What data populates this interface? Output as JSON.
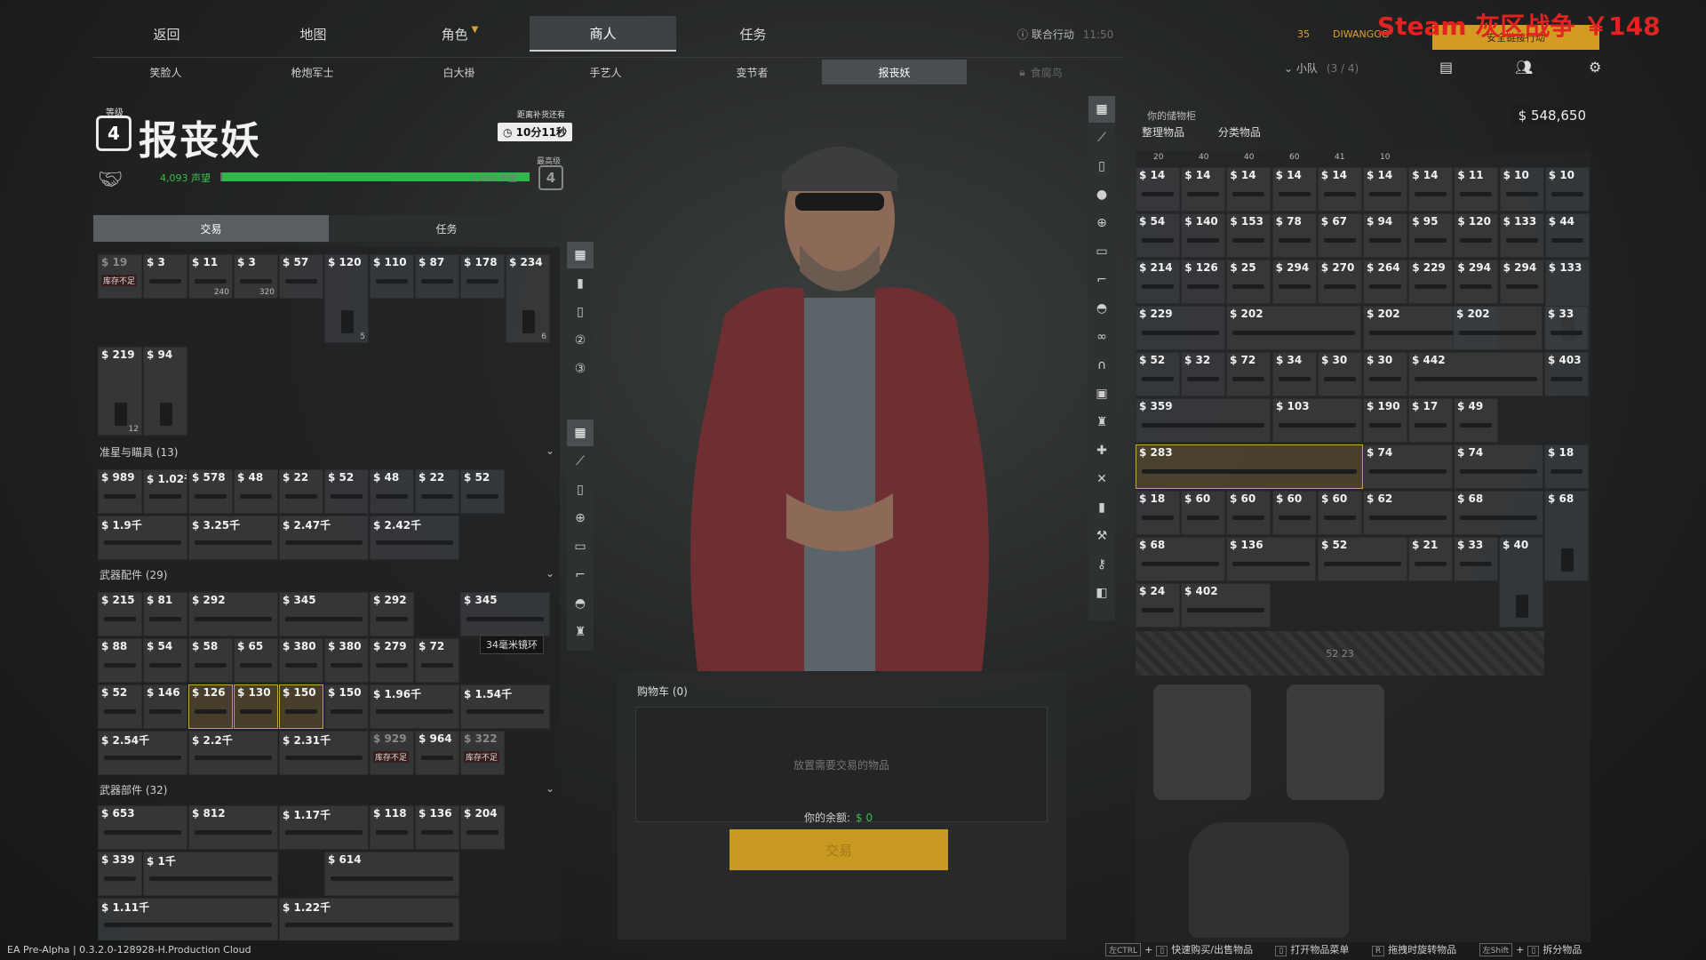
{
  "nav": {
    "tabs": [
      "返回",
      "地图",
      "角色",
      "商人",
      "任务"
    ],
    "active_index": 3,
    "joint_ops": "联合行动",
    "time": "11:50"
  },
  "subnav": {
    "tabs": [
      "笑脸人",
      "枪炮军士",
      "白大褂",
      "手艺人",
      "变节者",
      "报丧妖",
      "食腐鸟"
    ],
    "active_index": 5
  },
  "trader": {
    "level_label": "等级",
    "level": "4",
    "name": "报丧妖",
    "restock_label": "距离补货还有",
    "restock_timer": "10分11秒",
    "rep_current": "4,093 声望",
    "rep_max": "4,000 声望",
    "rep_fraction": 1.0,
    "max_label": "最高级",
    "max_level": "4"
  },
  "left_tabs": [
    "交易",
    "任务"
  ],
  "sections": {
    "sights": "准星与瞄具 (13)",
    "attachments": "武器配件 (29)",
    "parts": "武器部件 (32)"
  },
  "trader_items": {
    "row1": [
      {
        "p": "$ 19",
        "oos": "库存不足"
      },
      {
        "p": "$ 3"
      },
      {
        "p": "$ 11",
        "c": "240"
      },
      {
        "p": "$ 3",
        "c": "320"
      },
      {
        "p": "$ 57"
      },
      {
        "p": "$ 120",
        "c": "5"
      },
      {
        "p": "$ 110"
      },
      {
        "p": "$ 87"
      },
      {
        "p": "$ 178"
      },
      {
        "p": "$ 234",
        "c": "6"
      }
    ],
    "row2": [
      {
        "p": "$ 219",
        "c": "12"
      },
      {
        "p": "$ 94"
      }
    ],
    "sights_a": [
      "$ 989",
      "$ 1.02千",
      "$ 578",
      "$ 48",
      "$ 22",
      "$ 52",
      "$ 48",
      "$ 22",
      "$ 52"
    ],
    "sights_b": [
      "$ 1.9千",
      "$ 3.25千",
      "$ 2.47千",
      "$ 2.42千"
    ],
    "att_a": [
      "$ 215",
      "$ 81",
      "$ 292",
      "$ 345",
      "$ 292",
      "$ 345"
    ],
    "att_b": [
      "$ 88",
      "$ 54",
      "$ 58",
      "$ 65",
      "$ 380",
      "$ 380",
      "$ 279",
      "$ 72"
    ],
    "att_c": [
      "$ 52",
      "$ 146",
      "$ 126",
      "$ 130",
      "$ 150",
      "$ 150",
      "$ 1.96千",
      "$ 1.54千"
    ],
    "att_d": [
      "$ 2.54千",
      "$ 2.2千",
      "$ 2.31千",
      "$ 929",
      "$ 964",
      "$ 322"
    ],
    "parts_a": [
      "$ 653",
      "$ 812",
      "$ 1.17千",
      "$ 118",
      "$ 136",
      "$ 204"
    ],
    "parts_b": [
      "$ 339",
      "$ 1千",
      "$ 614"
    ],
    "parts_c": [
      "$ 1.11千",
      "$ 1.22千"
    ],
    "oos_label": "库存不足",
    "tooltip": "34毫米镜环"
  },
  "cart": {
    "title": "购物车 (0)",
    "drop_hint": "放置需要交易的物品",
    "balance_label": "你的余额:",
    "balance_value": "$ 0",
    "trade_button": "交易"
  },
  "player": {
    "level": "35",
    "name": "DIWANGGG",
    "safe_button": "安全链接行动",
    "overlay": "Steam  灰区战争 ￥148",
    "squad_label": "小队",
    "squad_count": "(3 / 4)"
  },
  "stash": {
    "title": "你的储物柜",
    "money": "$ 548,650",
    "sort": "整理物品",
    "categorize": "分类物品",
    "ammo_counts": [
      "20",
      "40",
      "40",
      "60",
      "41",
      "10"
    ],
    "row1": [
      "$ 14",
      "$ 14",
      "$ 14",
      "$ 14",
      "$ 14",
      "$ 14",
      "$ 14",
      "$ 11",
      "$ 10",
      "$ 10"
    ],
    "row2": [
      "$ 54",
      "$ 140",
      "$ 153",
      "$ 78",
      "$ 67",
      "$ 94",
      "$ 95",
      "$ 120",
      "$ 133",
      "$ 44"
    ],
    "row3": [
      "$ 214",
      "$ 126",
      "$ 25",
      "$ 294",
      "$ 270",
      "$ 264",
      "$ 229",
      "$ 294",
      "$ 294",
      "$ 133"
    ],
    "row4": [
      "$ 229",
      "$ 202",
      "$ 202",
      "$ 202",
      "$ 33"
    ],
    "row5": [
      "$ 52",
      "$ 32",
      "$ 72",
      "$ 34",
      "$ 30",
      "$ 30",
      "$ 442",
      "$ 403"
    ],
    "row6": [
      "$ 359",
      "$ 103",
      "$ 190",
      "$ 17",
      "$ 49"
    ],
    "row7": [
      "$ 283",
      "$ 74",
      "$ 74",
      "$ 18"
    ],
    "row8": [
      "$ 18",
      "$ 60",
      "$ 60",
      "$ 60",
      "$ 60",
      "$ 62",
      "$ 68",
      "$ 68"
    ],
    "row9": [
      "$ 68",
      "$ 136",
      "$ 52",
      "$ 21",
      "$ 33",
      "$ 40"
    ],
    "row10": [
      "$ 24",
      "$ 402"
    ],
    "locked_count": "52 23"
  },
  "footer": {
    "build": "EA Pre-Alpha | 0.3.2.0-128928-H.Production Cloud",
    "k1": "左CTRL",
    "l1": "快速购买/出售物品",
    "l2": "打开物品菜单",
    "k3": "R",
    "l3": "拖拽时旋转物品",
    "k4": "左Shift",
    "l4": "拆分物品"
  },
  "icons": [
    "grid-icon",
    "knife-icon",
    "magazine-icon",
    "grenade-icon",
    "scope-icon",
    "rail-icon",
    "grip-icon",
    "helmet-icon",
    "armor-icon",
    "backpack-icon",
    "settings-icon",
    "chat-icon",
    "friends-icon",
    "tools-icon",
    "box-icon"
  ],
  "colors": {
    "accent": "#d39a24",
    "rep": "#2fb84a",
    "overlay": "#e32222"
  }
}
